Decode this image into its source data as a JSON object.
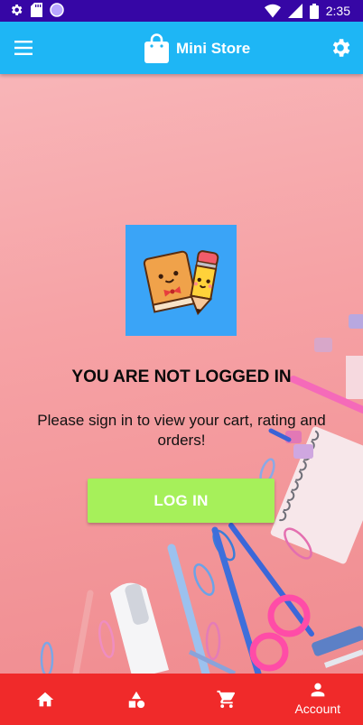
{
  "status_bar": {
    "time": "2:35"
  },
  "app_bar": {
    "title": "Mini Store"
  },
  "main": {
    "heading": "YOU ARE NOT LOGGED IN",
    "description": "Please sign in to view your cart, rating and orders!",
    "login_label": "LOG IN"
  },
  "bottom_nav": {
    "items": [
      {
        "icon": "home-icon",
        "label": ""
      },
      {
        "icon": "categories-icon",
        "label": ""
      },
      {
        "icon": "cart-icon",
        "label": ""
      },
      {
        "icon": "account-icon",
        "label": "Account",
        "active": true
      }
    ]
  },
  "colors": {
    "status_bar": "#3606a5",
    "app_bar": "#1eb6f5",
    "login_button": "#a6f05a",
    "bottom_nav": "#f02a2a",
    "logo_tile": "#3aa4f7"
  }
}
